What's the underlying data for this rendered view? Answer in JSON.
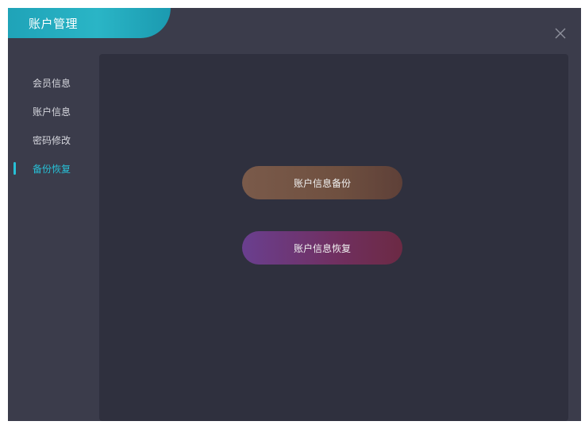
{
  "window": {
    "title": "账户管理"
  },
  "sidebar": {
    "items": [
      {
        "label": "会员信息"
      },
      {
        "label": "账户信息"
      },
      {
        "label": "密码修改"
      },
      {
        "label": "备份恢复"
      }
    ],
    "active_index": 3
  },
  "main": {
    "backup_label": "账户信息备份",
    "restore_label": "账户信息恢复"
  },
  "colors": {
    "accent": "#27c0d6",
    "window_bg": "#3b3c4b",
    "panel_bg": "#2f303e"
  },
  "icons": {
    "close": "close-icon"
  }
}
